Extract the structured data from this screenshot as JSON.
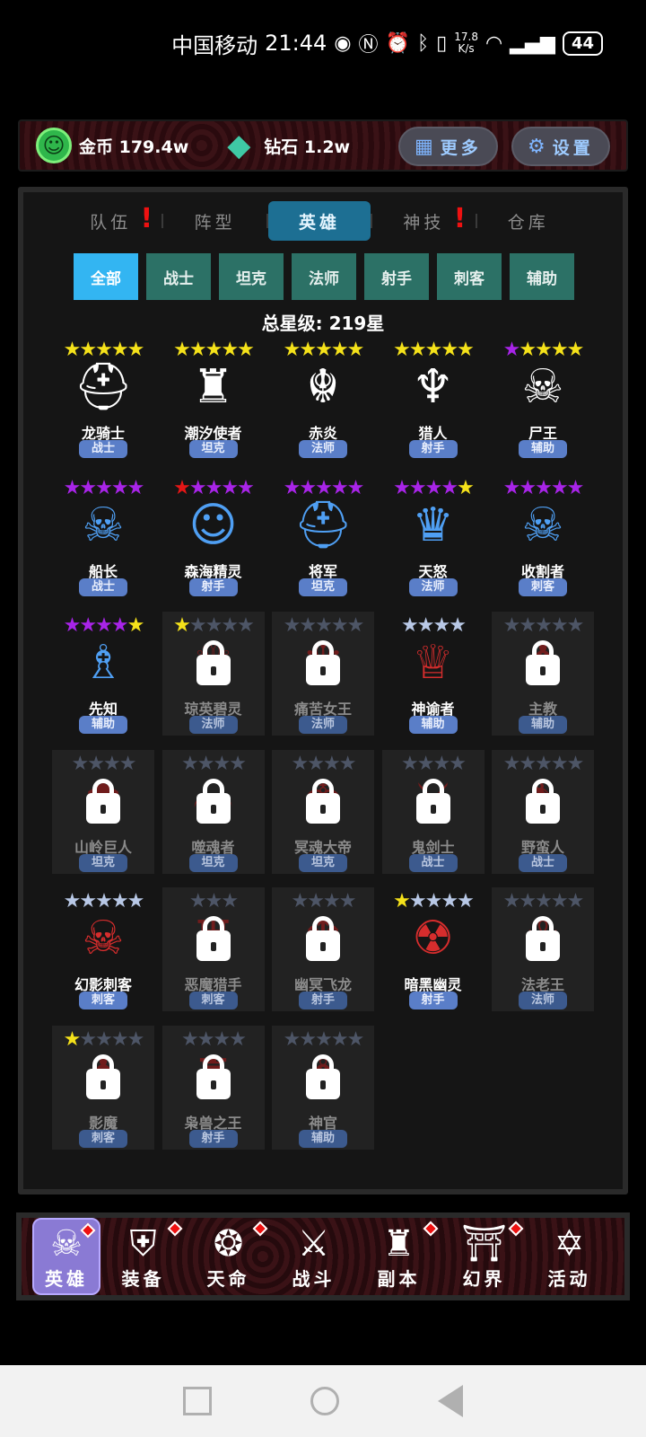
{
  "status_bar": {
    "carrier": "中国移动",
    "time": "21:44",
    "speed_value": "17.8",
    "speed_unit": "K/s",
    "battery": "44"
  },
  "resources": {
    "gold_label": "金币 179.4w",
    "diamond_label": "钻石 1.2w",
    "more_label": "更多",
    "settings_label": "设置"
  },
  "tabs": [
    {
      "label": "队伍",
      "alert": true
    },
    {
      "label": "阵型",
      "alert": false
    },
    {
      "label": "英雄",
      "alert": false,
      "active": true
    },
    {
      "label": "神技",
      "alert": true
    },
    {
      "label": "仓库",
      "alert": false
    }
  ],
  "filters": [
    "全部",
    "战士",
    "坦克",
    "法师",
    "射手",
    "刺客",
    "辅助"
  ],
  "total_stars_label": "总星级: 219星",
  "star_colors": {
    "gold": "#f5e21a",
    "purple": "#a824e8",
    "red": "#e51616",
    "silver": "#b8c8e6",
    "empty": "#4d5566"
  },
  "heroes": [
    {
      "name": "龙骑士",
      "role": "战士",
      "locked": false,
      "stars": [
        "gold",
        "gold",
        "gold",
        "gold",
        "gold"
      ],
      "icon": "viking-helmet-icon",
      "glyph": "⛑",
      "color": "#ffffff"
    },
    {
      "name": "潮汐使者",
      "role": "坦克",
      "locked": false,
      "stars": [
        "gold",
        "gold",
        "gold",
        "gold",
        "gold"
      ],
      "icon": "knight-icon",
      "glyph": "♜",
      "color": "#ffffff"
    },
    {
      "name": "赤炎",
      "role": "法师",
      "locked": false,
      "stars": [
        "gold",
        "gold",
        "gold",
        "gold",
        "gold"
      ],
      "icon": "demon-mask-icon",
      "glyph": "☬",
      "color": "#ffffff"
    },
    {
      "name": "猎人",
      "role": "射手",
      "locked": false,
      "stars": [
        "gold",
        "gold",
        "gold",
        "gold",
        "gold"
      ],
      "icon": "hunter-icon",
      "glyph": "♆",
      "color": "#ffffff"
    },
    {
      "name": "尸王",
      "role": "辅助",
      "locked": false,
      "stars": [
        "purple",
        "gold",
        "gold",
        "gold",
        "gold"
      ],
      "icon": "zombie-icon",
      "glyph": "☠",
      "color": "#ffffff"
    },
    {
      "name": "船长",
      "role": "战士",
      "locked": false,
      "stars": [
        "purple",
        "purple",
        "purple",
        "purple",
        "purple"
      ],
      "icon": "pirate-icon",
      "glyph": "☠",
      "color": "#4f9ff3"
    },
    {
      "name": "森海精灵",
      "role": "射手",
      "locked": false,
      "stars": [
        "red",
        "purple",
        "purple",
        "purple",
        "purple"
      ],
      "icon": "elf-icon",
      "glyph": "☺",
      "color": "#4f9ff3"
    },
    {
      "name": "将军",
      "role": "坦克",
      "locked": false,
      "stars": [
        "purple",
        "purple",
        "purple",
        "purple",
        "purple"
      ],
      "icon": "general-icon",
      "glyph": "⛑",
      "color": "#4f9ff3"
    },
    {
      "name": "天怒",
      "role": "法师",
      "locked": false,
      "stars": [
        "purple",
        "purple",
        "purple",
        "purple",
        "gold"
      ],
      "icon": "goddess-icon",
      "glyph": "♛",
      "color": "#4f9ff3"
    },
    {
      "name": "收割者",
      "role": "刺客",
      "locked": false,
      "stars": [
        "purple",
        "purple",
        "purple",
        "purple",
        "purple"
      ],
      "icon": "reaper-icon",
      "glyph": "☠",
      "color": "#4f9ff3"
    },
    {
      "name": "先知",
      "role": "辅助",
      "locked": false,
      "stars": [
        "purple",
        "purple",
        "purple",
        "purple",
        "gold"
      ],
      "icon": "prophet-icon",
      "glyph": "♗",
      "color": "#4f9ff3"
    },
    {
      "name": "琼英碧灵",
      "role": "法师",
      "locked": true,
      "stars": [
        "gold",
        "empty",
        "empty",
        "empty",
        "empty"
      ],
      "icon": "fairy-icon",
      "glyph": "♕",
      "color": "#8b1a1a"
    },
    {
      "name": "痛苦女王",
      "role": "法师",
      "locked": true,
      "stars": [
        "empty",
        "empty",
        "empty",
        "empty",
        "empty"
      ],
      "icon": "queen-icon",
      "glyph": "♛",
      "color": "#8b1a1a"
    },
    {
      "name": "神谕者",
      "role": "辅助",
      "locked": false,
      "stars": [
        "silver",
        "silver",
        "silver",
        "silver"
      ],
      "icon": "oracle-icon",
      "glyph": "♕",
      "color": "#d62d2d"
    },
    {
      "name": "主教",
      "role": "辅助",
      "locked": true,
      "stars": [
        "empty",
        "empty",
        "empty",
        "empty",
        "empty"
      ],
      "icon": "bishop-icon",
      "glyph": "♝",
      "color": "#8b1a1a"
    },
    {
      "name": "山岭巨人",
      "role": "坦克",
      "locked": true,
      "stars": [
        "empty",
        "empty",
        "empty",
        "empty"
      ],
      "icon": "giant-icon",
      "glyph": "☗",
      "color": "#8b1a1a"
    },
    {
      "name": "噬魂者",
      "role": "坦克",
      "locked": true,
      "stars": [
        "empty",
        "empty",
        "empty",
        "empty"
      ],
      "icon": "soul-eater-icon",
      "glyph": "☣",
      "color": "#8b1a1a"
    },
    {
      "name": "冥魂大帝",
      "role": "坦克",
      "locked": true,
      "stars": [
        "empty",
        "empty",
        "empty",
        "empty"
      ],
      "icon": "emperor-icon",
      "glyph": "♚",
      "color": "#8b1a1a"
    },
    {
      "name": "鬼剑士",
      "role": "战士",
      "locked": true,
      "stars": [
        "empty",
        "empty",
        "empty",
        "empty"
      ],
      "icon": "ghost-swordsman-icon",
      "glyph": "⚔",
      "color": "#8b1a1a"
    },
    {
      "name": "野蛮人",
      "role": "战士",
      "locked": true,
      "stars": [
        "empty",
        "empty",
        "empty",
        "empty",
        "empty"
      ],
      "icon": "barbarian-icon",
      "glyph": "♞",
      "color": "#8b1a1a"
    },
    {
      "name": "幻影刺客",
      "role": "刺客",
      "locked": false,
      "stars": [
        "silver",
        "silver",
        "silver",
        "silver",
        "silver"
      ],
      "icon": "skull-reaper-icon",
      "glyph": "☠",
      "color": "#d62d2d"
    },
    {
      "name": "恶魔猎手",
      "role": "刺客",
      "locked": true,
      "stars": [
        "empty",
        "empty",
        "empty"
      ],
      "icon": "demon-hunter-icon",
      "glyph": "♅",
      "color": "#8b1a1a"
    },
    {
      "name": "幽冥飞龙",
      "role": "射手",
      "locked": true,
      "stars": [
        "empty",
        "empty",
        "empty",
        "empty"
      ],
      "icon": "dragon-icon",
      "glyph": "♆",
      "color": "#8b1a1a"
    },
    {
      "name": "暗黑幽灵",
      "role": "射手",
      "locked": false,
      "stars": [
        "gold",
        "silver",
        "silver",
        "silver",
        "silver"
      ],
      "icon": "dark-ghost-icon",
      "glyph": "☢",
      "color": "#d62d2d"
    },
    {
      "name": "法老王",
      "role": "法师",
      "locked": true,
      "stars": [
        "empty",
        "empty",
        "empty",
        "empty",
        "empty"
      ],
      "icon": "pharaoh-icon",
      "glyph": "☥",
      "color": "#8b1a1a"
    },
    {
      "name": "影魔",
      "role": "刺客",
      "locked": true,
      "stars": [
        "gold",
        "empty",
        "empty",
        "empty",
        "empty"
      ],
      "icon": "shadow-fiend-icon",
      "glyph": "♟",
      "color": "#8b1a1a"
    },
    {
      "name": "枭兽之王",
      "role": "射手",
      "locked": true,
      "stars": [
        "empty",
        "empty",
        "empty",
        "empty"
      ],
      "icon": "owl-king-icon",
      "glyph": "♜",
      "color": "#8b1a1a"
    },
    {
      "name": "神官",
      "role": "辅助",
      "locked": true,
      "stars": [
        "empty",
        "empty",
        "empty",
        "empty",
        "empty"
      ],
      "icon": "priest-icon",
      "glyph": "♗",
      "color": "#8b1a1a"
    }
  ],
  "bottom_nav": [
    {
      "label": "英雄",
      "icon": "skull-hero-icon",
      "glyph": "☠",
      "active": true,
      "badge": true
    },
    {
      "label": "装备",
      "icon": "armor-icon",
      "glyph": "⛨",
      "active": false,
      "badge": true
    },
    {
      "label": "天命",
      "icon": "fate-icon",
      "glyph": "❂",
      "active": false,
      "badge": true
    },
    {
      "label": "战斗",
      "icon": "crossed-swords-icon",
      "glyph": "⚔",
      "active": false,
      "badge": false
    },
    {
      "label": "副本",
      "icon": "castle-icon",
      "glyph": "♜",
      "active": false,
      "badge": true
    },
    {
      "label": "幻界",
      "icon": "portal-icon",
      "glyph": "⛩",
      "active": false,
      "badge": true
    },
    {
      "label": "活动",
      "icon": "scroll-icon",
      "glyph": "✡",
      "active": false,
      "badge": false
    }
  ]
}
